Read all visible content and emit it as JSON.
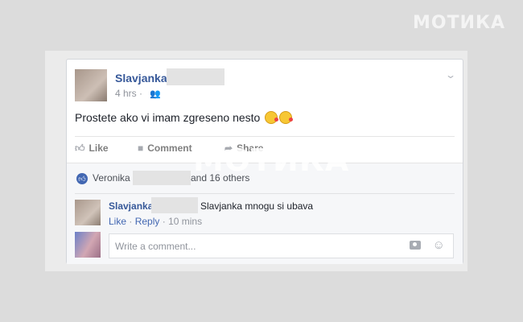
{
  "watermark": "МОТИКА",
  "post": {
    "author": "Slavjanka",
    "time": "4 hrs",
    "audience_icon": "friends-icon",
    "text": "Prostete ako vi imam zgreseno nesto"
  },
  "actions": {
    "like": "Like",
    "comment": "Comment",
    "share": "Share"
  },
  "reactions": {
    "name": "Veronika",
    "others": "and 16 others"
  },
  "comment": {
    "author": "Slavjanka",
    "text": "Slavjanka mnogu si ubava",
    "like": "Like",
    "reply": "Reply",
    "time": "10 mins"
  },
  "composer": {
    "placeholder": "Write a comment..."
  },
  "colors": {
    "link": "#365899",
    "accent": "#4267b2"
  }
}
